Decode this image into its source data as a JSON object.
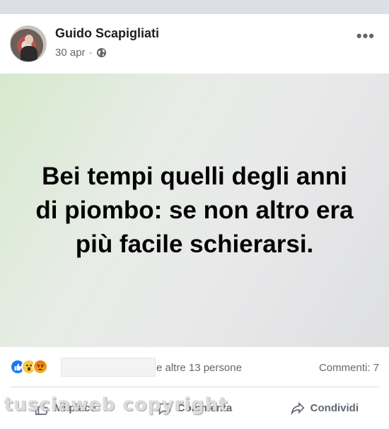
{
  "post": {
    "author": "Guido Scapigliati",
    "date": "30 apr",
    "separator": "·",
    "privacy_icon": "globe-icon",
    "more_label": "•••",
    "text_lines": [
      "Bei tempi quelli degli anni",
      "di piombo: se non altro era",
      "più facile schierarsi."
    ],
    "background_colors": [
      "#d6e9cd",
      "#e9e9ea"
    ]
  },
  "stats": {
    "reactions": [
      "like-icon",
      "wow-icon",
      "angry-icon"
    ],
    "others_text": "e altre 13 persone",
    "comments_text": "Commenti: 7"
  },
  "actions": {
    "like_label": "Mi piace",
    "comment_label": "Commenta",
    "share_label": "Condividi"
  },
  "watermark": "tusciaweb copyright"
}
